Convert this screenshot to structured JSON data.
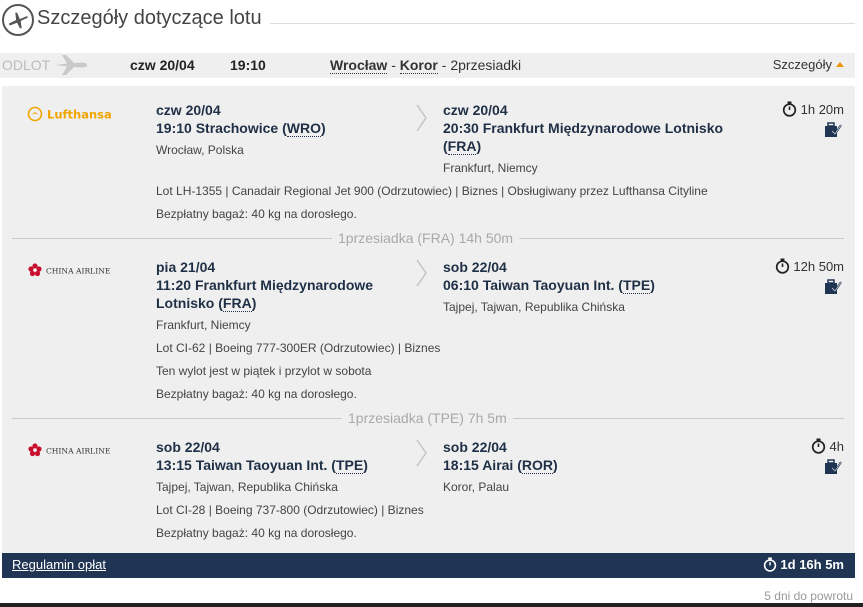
{
  "header": {
    "title": "Szczegóły dotyczące lotu"
  },
  "odlot": {
    "label": "ODLOT",
    "date": "czw 20/04",
    "time": "19:10",
    "from": "Wrocław",
    "route_sep": " - ",
    "to": "Koror",
    "stops": " - 2przesiadki",
    "details_label": "Szczegóły"
  },
  "segments": [
    {
      "airline": "Lufthansa",
      "dep_date": "czw 20/04",
      "dep_time": "19:10",
      "dep_airport": "Strachowice",
      "dep_code": "WRO",
      "dep_loc": "Wrocław, Polska",
      "arr_date": "czw 20/04",
      "arr_time": "20:30",
      "arr_airport": "Frankfurt Międzynarodowe Lotnisko",
      "arr_code": "FRA",
      "arr_loc": "Frankfurt, Niemcy",
      "duration": "1h 20m",
      "flight_info": "Lot LH-1355 |  Canadair Regional Jet 900 (Odrzutowiec) |  Biznes |  Obsługiwany przez Lufthansa Cityline",
      "note": "",
      "baggage": "Bezpłatny bagaż: 40 kg na dorosłego."
    },
    {
      "airline": "CHINA AIRLINES",
      "dep_date": "pia 21/04",
      "dep_time": "11:20",
      "dep_airport": "Frankfurt Międzynarodowe Lotnisko",
      "dep_code": "FRA",
      "dep_loc": "Frankfurt, Niemcy",
      "arr_date": "sob 22/04",
      "arr_time": "06:10",
      "arr_airport": "Taiwan Taoyuan Int.",
      "arr_code": "TPE",
      "arr_loc": "Tajpej, Tajwan, Republika Chińska",
      "duration": "12h 50m",
      "flight_info": "Lot CI-62 |  Boeing 777-300ER (Odrzutowiec) |  Biznes",
      "note": "Ten wylot jest w piątek i przylot w sobota",
      "baggage": "Bezpłatny bagaż: 40 kg na dorosłego."
    },
    {
      "airline": "CHINA AIRLINES",
      "dep_date": "sob 22/04",
      "dep_time": "13:15",
      "dep_airport": "Taiwan Taoyuan Int.",
      "dep_code": "TPE",
      "dep_loc": "Tajpej, Tajwan, Republika Chińska",
      "arr_date": "sob 22/04",
      "arr_time": "18:15",
      "arr_airport": "Airai",
      "arr_code": "ROR",
      "arr_loc": "Koror, Palau",
      "duration": "4h",
      "flight_info": "Lot CI-28 |  Boeing 737-800 (Odrzutowiec) |  Biznes",
      "note": "",
      "baggage": "Bezpłatny bagaż: 40 kg na dorosłego."
    }
  ],
  "layovers": [
    {
      "text": "1przesiadka (FRA) 14h 50m"
    },
    {
      "text": "1przesiadka (TPE) 7h 5m"
    }
  ],
  "footer": {
    "rules_link": "Regulamin opłat",
    "total_duration": "1d 16h 5m"
  },
  "return_info": "5 dni do powrotu",
  "colors": {
    "accent": "#f29100",
    "navy": "#1f3553",
    "lufthansa": "#f0a500",
    "china_airlines": "#c8102e"
  }
}
